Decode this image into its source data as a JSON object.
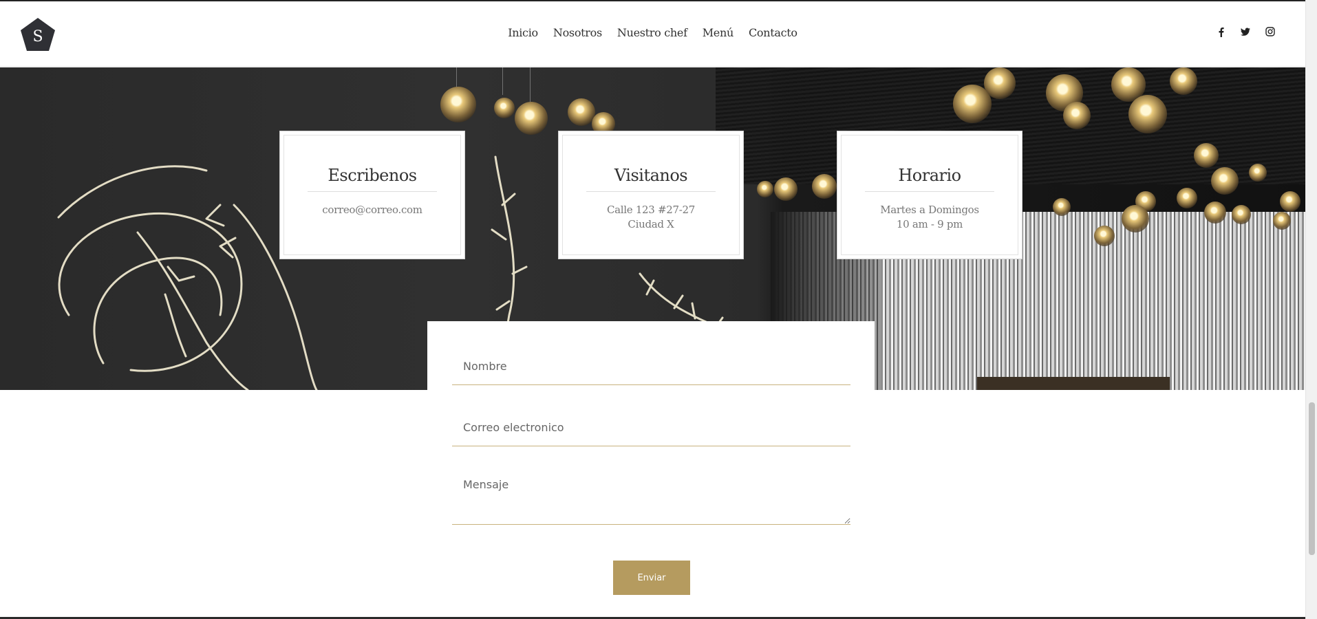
{
  "header": {
    "logo_letter": "S",
    "nav": [
      "Inicio",
      "Nosotros",
      "Nuestro chef",
      "Menú",
      "Contacto"
    ],
    "social_icons": [
      "facebook-icon",
      "twitter-icon",
      "instagram-icon"
    ]
  },
  "cards": [
    {
      "title": "Escribenos",
      "line1": "correo@correo.com",
      "line2": ""
    },
    {
      "title": "Visitanos",
      "line1": "Calle 123 #27-27",
      "line2": "Ciudad X"
    },
    {
      "title": "Horario",
      "line1": "Martes a Domingos",
      "line2": "10 am - 9 pm"
    }
  ],
  "form": {
    "name_placeholder": "Nombre",
    "email_placeholder": "Correo electronico",
    "message_placeholder": "Mensaje",
    "submit_label": "Enviar"
  },
  "colors": {
    "accent": "#b59b5f",
    "logo": "#2f3035"
  }
}
